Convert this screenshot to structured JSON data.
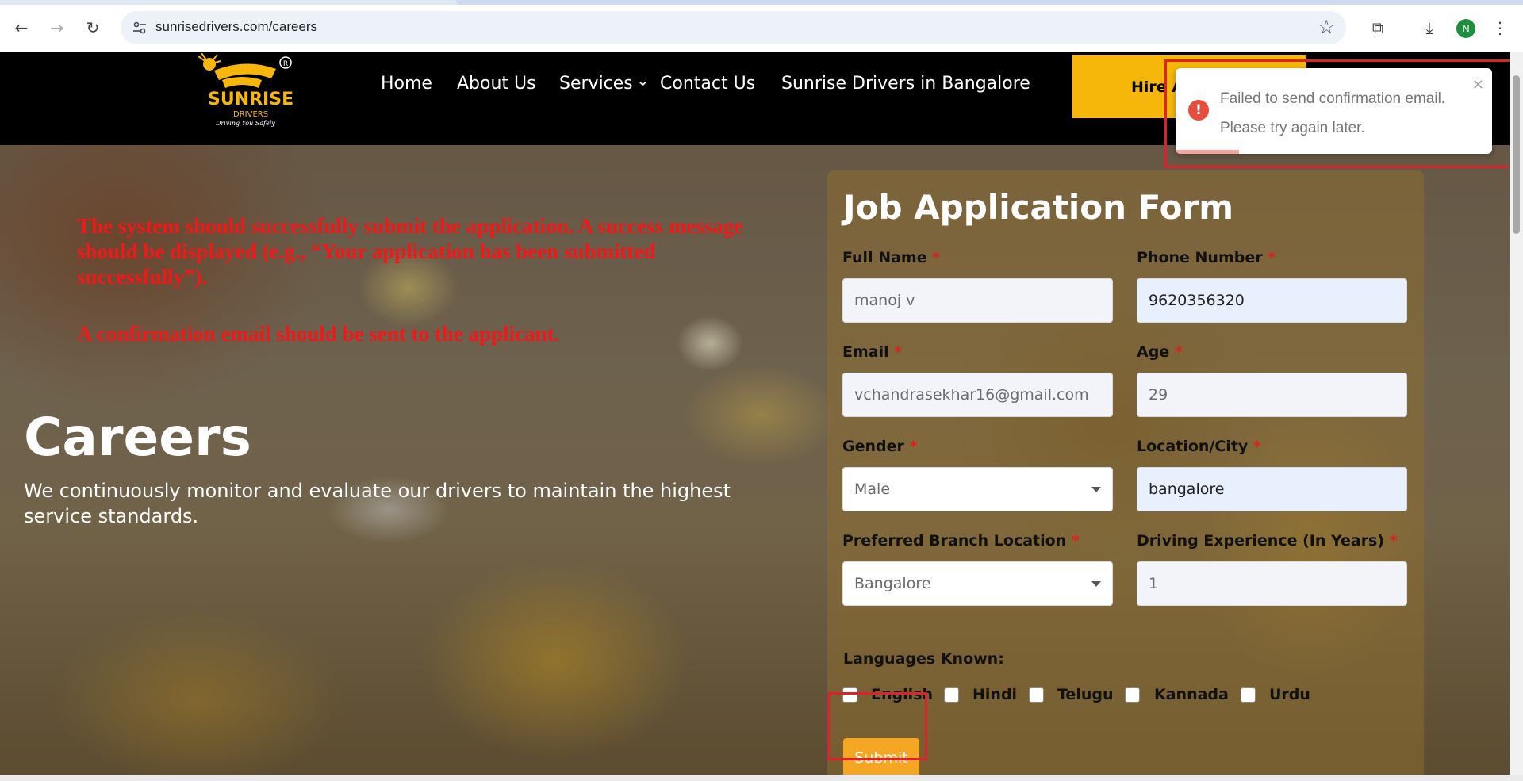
{
  "browser": {
    "url": "sunrisedrivers.com/careers",
    "profile_initial": "N",
    "back_icon": "←",
    "forward_icon": "→",
    "reload_icon": "↻",
    "star_icon": "☆",
    "extensions_icon": "⧉",
    "download_icon": "⤓",
    "menu_icon": "⋮"
  },
  "site_nav": {
    "logo_text": "SUNRISE",
    "logo_sub": "DRIVERS",
    "logo_tagline": "Driving You Safely",
    "items": [
      "Home",
      "About Us",
      "Services",
      "Contact Us",
      "Sunrise Drivers in Bangalore"
    ],
    "services_caret": "⌄",
    "hire_button": "Hire A Driver"
  },
  "annotations": {
    "line1": "The system should successfully submit the application. A success message",
    "line2": "should be displayed (e.g., “Your application has been submitted",
    "line3": "successfully”).",
    "line4": "A confirmation email should be sent to the applicant."
  },
  "hero": {
    "title": "Careers",
    "subtitle": "We continuously monitor and evaluate our drivers to maintain the highest service standards."
  },
  "form": {
    "title": "Job Application Form",
    "required_mark": "*",
    "fields": {
      "full_name": {
        "label": "Full Name",
        "value": "manoj v"
      },
      "phone": {
        "label": "Phone Number",
        "value": "9620356320"
      },
      "email": {
        "label": "Email",
        "value": "vchandrasekhar16@gmail.com"
      },
      "age": {
        "label": "Age",
        "value": "29"
      },
      "gender": {
        "label": "Gender",
        "value": "Male"
      },
      "location": {
        "label": "Location/City",
        "value": "bangalore"
      },
      "branch": {
        "label": "Preferred Branch Location",
        "value": "Bangalore"
      },
      "experience": {
        "label": "Driving Experience (In Years)",
        "value": "1"
      }
    },
    "languages_label": "Languages Known:",
    "languages": [
      "English",
      "Hindi",
      "Telugu",
      "Kannada",
      "Urdu"
    ],
    "submit_label": "Submit"
  },
  "toast": {
    "line1": "Failed to send confirmation email.",
    "line2": "Please try again later.",
    "icon": "!",
    "close": "×",
    "progress": 0.2
  },
  "colors": {
    "accent": "#f7b70a",
    "error": "#e74c3c",
    "annotation": "#f01818"
  }
}
